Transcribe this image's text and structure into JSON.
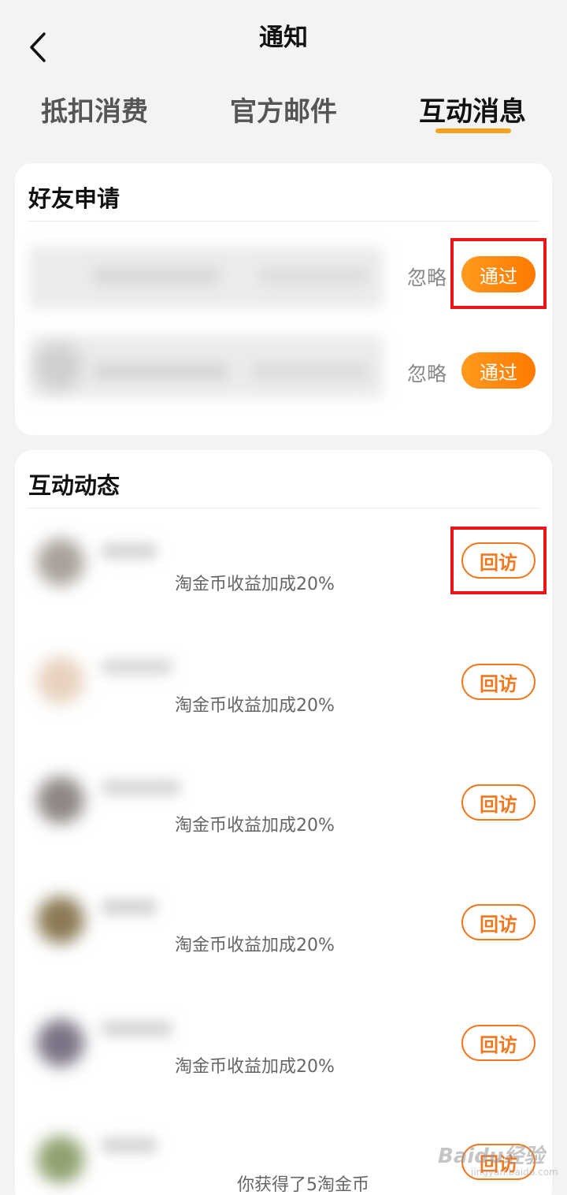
{
  "header": {
    "title": "通知",
    "back_icon": "chevron-left-icon"
  },
  "tabs": [
    {
      "label": "抵扣消费",
      "active": false
    },
    {
      "label": "官方邮件",
      "active": false
    },
    {
      "label": "互动消息",
      "active": true
    }
  ],
  "accent_color": "#f7a21b",
  "friend_requests": {
    "title": "好友申请",
    "items": [
      {
        "ignore_label": "忽略",
        "approve_label": "通过"
      },
      {
        "ignore_label": "忽略",
        "approve_label": "通过"
      }
    ]
  },
  "activity": {
    "title": "互动动态",
    "items": [
      {
        "desc": "淘金币收益加成20%",
        "visit_label": "回访"
      },
      {
        "desc": "淘金币收益加成20%",
        "visit_label": "回访"
      },
      {
        "desc": "淘金币收益加成20%",
        "visit_label": "回访"
      },
      {
        "desc": "淘金币收益加成20%",
        "visit_label": "回访"
      },
      {
        "desc": "淘金币收益加成20%",
        "visit_label": "回访"
      },
      {
        "desc": "你获得了5淘金币",
        "visit_label": "回访"
      }
    ]
  },
  "watermark": {
    "text": "Baidu经验",
    "sub": "jingyan.baidu.com"
  }
}
